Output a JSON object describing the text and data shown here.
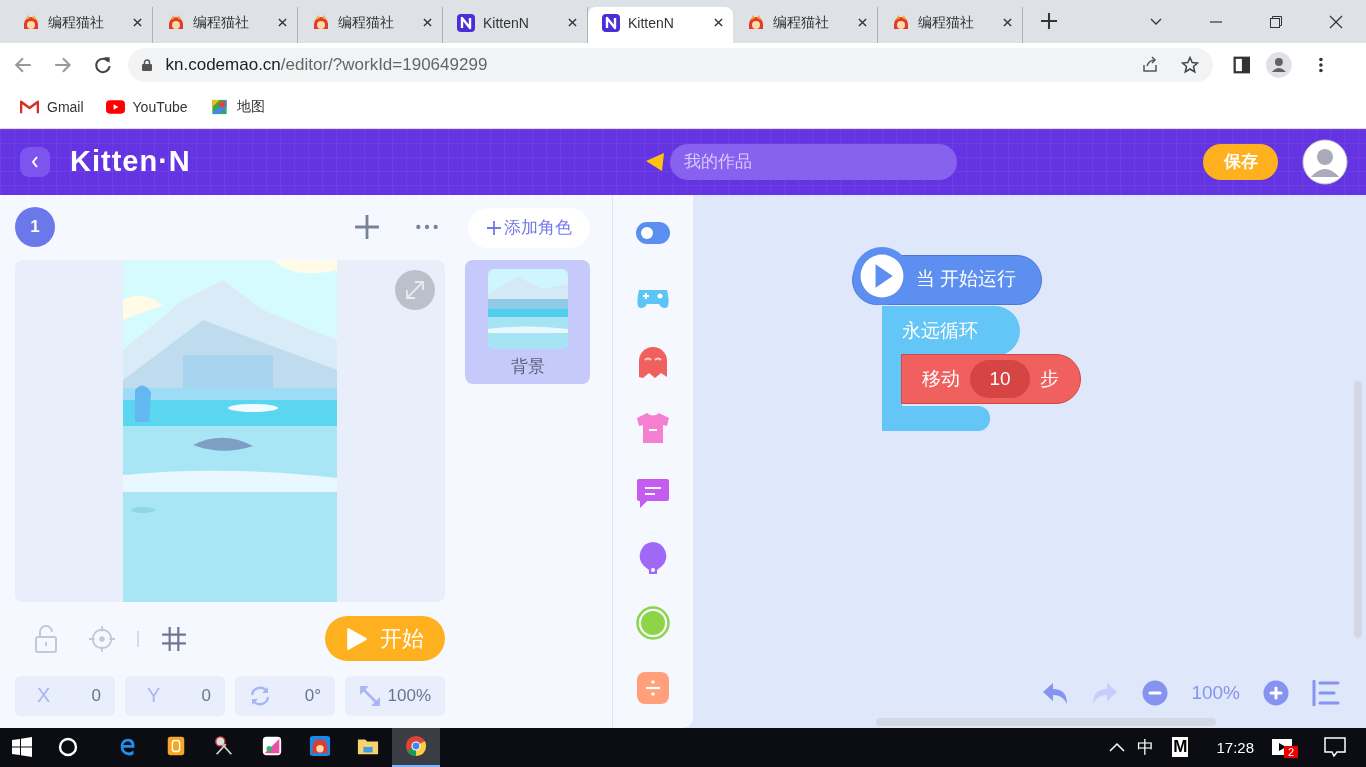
{
  "browser": {
    "tabs": [
      {
        "title": "编程猫社",
        "kind": "codemao",
        "selected": false
      },
      {
        "title": "编程猫社",
        "kind": "codemao",
        "selected": false
      },
      {
        "title": "编程猫社",
        "kind": "codemao",
        "selected": false
      },
      {
        "title": "KittenN",
        "kind": "kitten",
        "selected": false
      },
      {
        "title": "KittenN",
        "kind": "kitten",
        "selected": true
      },
      {
        "title": "编程猫社",
        "kind": "codemao",
        "selected": false
      },
      {
        "title": "编程猫社",
        "kind": "codemao",
        "selected": false
      }
    ],
    "address": {
      "host": "kn.codemao.cn",
      "path": "/editor/?workId=190649299"
    },
    "bookmarks": [
      {
        "kind": "gmail",
        "label": "Gmail"
      },
      {
        "kind": "youtube",
        "label": "YouTube"
      },
      {
        "kind": "maps",
        "label": "地图"
      }
    ]
  },
  "header": {
    "logo": "Kitten·N",
    "work_name_placeholder": "我的作品",
    "save": "保存"
  },
  "stage": {
    "scene_number": "1",
    "add_role": "添加角色",
    "start": "开始",
    "grid_on": true
  },
  "roles": [
    {
      "name": "背景",
      "selected": true
    }
  ],
  "props": [
    {
      "kind": "x",
      "label": "X",
      "value": "0"
    },
    {
      "kind": "y",
      "label": "Y",
      "value": "0"
    },
    {
      "kind": "rotation",
      "value": "0°"
    },
    {
      "kind": "scale",
      "value": "100%"
    }
  ],
  "categories": [
    {
      "kind": "toggle",
      "color": "#5b8ef0"
    },
    {
      "kind": "gamepad",
      "color": "#5cc4f7"
    },
    {
      "kind": "ghost",
      "color": "#f0605e"
    },
    {
      "kind": "shirt",
      "color": "#f57fd0"
    },
    {
      "kind": "chat",
      "color": "#c45cf0"
    },
    {
      "kind": "bulb",
      "color": "#a069f5"
    },
    {
      "kind": "ring",
      "color": "#8dd446"
    },
    {
      "kind": "divide",
      "color": "#ffa07a"
    }
  ],
  "script": {
    "hat": "当 开始运行",
    "loop": "永远循环",
    "move": {
      "label": "移动",
      "value": "10",
      "unit": "步"
    }
  },
  "zoom": "100%",
  "taskbar": {
    "apps": [
      {
        "kind": "ie",
        "selected": false
      },
      {
        "kind": "note",
        "selected": false
      },
      {
        "kind": "scissors",
        "selected": false
      },
      {
        "kind": "paint",
        "selected": false
      },
      {
        "kind": "codemao",
        "selected": false
      },
      {
        "kind": "folder",
        "selected": false
      },
      {
        "kind": "chrome",
        "selected": true
      }
    ],
    "tray": [
      "中",
      "M"
    ],
    "time": "17:28",
    "notification_count": "2"
  }
}
